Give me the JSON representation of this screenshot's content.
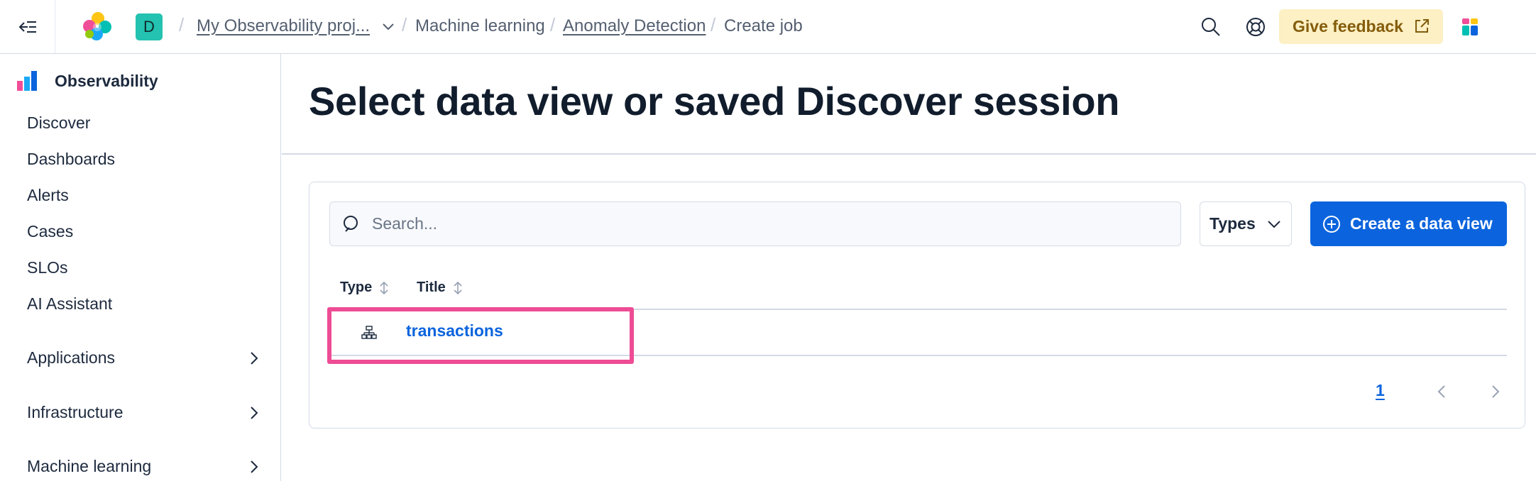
{
  "header": {
    "project_avatar_letter": "D",
    "breadcrumbs": [
      {
        "label": "My Observability proj...",
        "link": true
      },
      {
        "label": "Machine learning",
        "link": false
      },
      {
        "label": "Anomaly Detection",
        "link": true
      },
      {
        "label": "Create job",
        "link": false
      }
    ],
    "feedback_label": "Give feedback"
  },
  "sidebar": {
    "brand": "Observability",
    "items": [
      "Discover",
      "Dashboards",
      "Alerts",
      "Cases",
      "SLOs",
      "AI Assistant"
    ],
    "groups": [
      "Applications",
      "Infrastructure",
      "Machine learning"
    ]
  },
  "main": {
    "title": "Select data view or saved Discover session",
    "search_placeholder": "Search...",
    "types_label": "Types",
    "create_label": "Create a data view",
    "columns": [
      "Type",
      "Title"
    ],
    "rows": [
      {
        "type_icon": "data-view-icon",
        "title": "transactions"
      }
    ],
    "pagination": {
      "current_page": "1"
    }
  },
  "colors": {
    "accent": "#0b64dd",
    "highlight": "#ee4c95",
    "feedback_bg": "#fcf0c4",
    "avatar_bg": "#24c2b0"
  }
}
